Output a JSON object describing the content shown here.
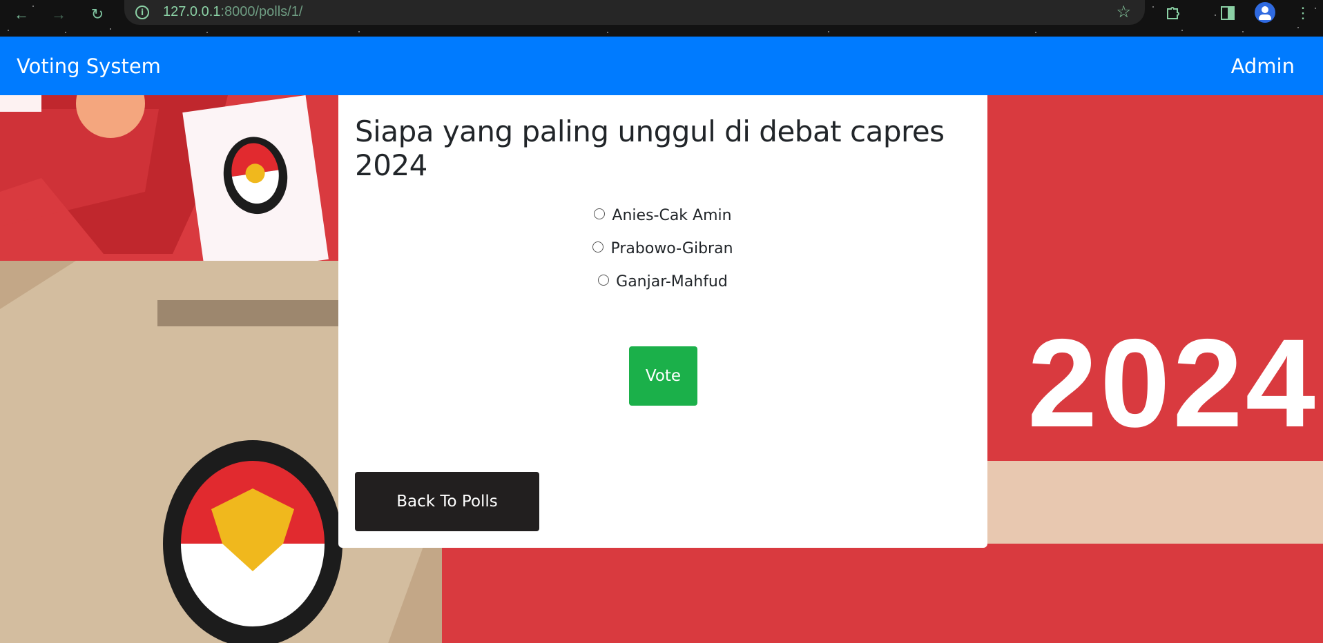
{
  "browser": {
    "url_host": "127.0.0.1",
    "url_rest": ":8000/polls/1/"
  },
  "navbar": {
    "brand": "Voting System",
    "admin_link": "Admin"
  },
  "background": {
    "year_text": "2024"
  },
  "poll": {
    "question": "Siapa yang paling unggul di debat capres 2024",
    "choices": [
      {
        "label": "Anies-Cak Amin",
        "selected": false
      },
      {
        "label": "Prabowo-Gibran",
        "selected": false
      },
      {
        "label": "Ganjar-Mahfud",
        "selected": false
      }
    ],
    "vote_label": "Vote",
    "back_label": "Back To Polls"
  },
  "colors": {
    "navbar": "#007bff",
    "vote_button": "#1bb04a",
    "back_button": "#221f1f",
    "background_red": "#d93a3f"
  }
}
